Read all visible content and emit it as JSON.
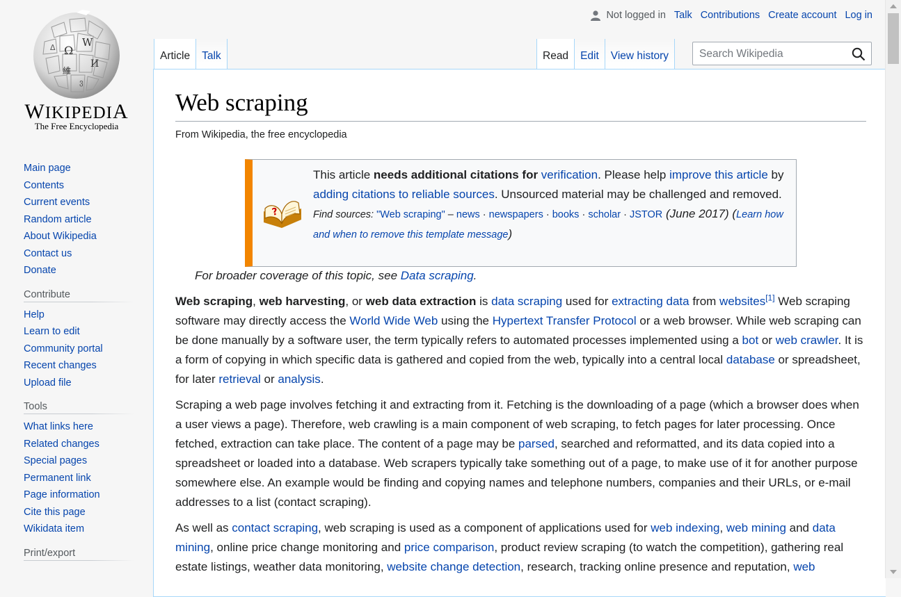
{
  "logo": {
    "wordmark": "Wikipedia",
    "tagline": "The Free Encyclopedia"
  },
  "personal": {
    "user_icon": "user-icon",
    "not_logged_in": "Not logged in",
    "talk": "Talk",
    "contributions": "Contributions",
    "create_account": "Create account",
    "login": "Log in"
  },
  "tabs_left": [
    "Article",
    "Talk"
  ],
  "tabs_right": [
    "Read",
    "Edit",
    "View history"
  ],
  "search": {
    "placeholder": "Search Wikipedia",
    "icon": "magnifier-icon"
  },
  "sidebar": {
    "navigation": [
      "Main page",
      "Contents",
      "Current events",
      "Random article",
      "About Wikipedia",
      "Contact us",
      "Donate"
    ],
    "contribute_heading": "Contribute",
    "contribute": [
      "Help",
      "Learn to edit",
      "Community portal",
      "Recent changes",
      "Upload file"
    ],
    "tools_heading": "Tools",
    "tools": [
      "What links here",
      "Related changes",
      "Special pages",
      "Permanent link",
      "Page information",
      "Cite this page",
      "Wikidata item"
    ],
    "print_heading": "Print/export"
  },
  "article": {
    "title": "Web scraping",
    "site_sub": "From Wikipedia, the free encyclopedia",
    "ambox": {
      "icon": "book-question-icon",
      "t1": "This article ",
      "t2": "needs additional citations for ",
      "t3": "verification",
      "t4": ". Please help ",
      "t5": "improve this article",
      "t6": " by ",
      "t7": "adding citations to reliable sources",
      "t8": ". Unsourced material may be challenged and removed.",
      "fs_label": "Find sources: ",
      "fs_query": "\"Web scraping\"",
      "fs_dash": " – ",
      "fs_news": "news",
      "fs_newspapers": "newspapers",
      "fs_books": "books",
      "fs_scholar": "scholar",
      "fs_jstor": "JSTOR",
      "sep": " · ",
      "date": " (June 2017) ",
      "learn": "Learn how and when to remove this template message",
      "open_paren": "(",
      "close_paren": ")"
    },
    "hatnote": {
      "text": "For broader coverage of this topic, see ",
      "link": "Data scraping",
      "end": "."
    },
    "p1": {
      "b1": "Web scraping",
      "s1": ", ",
      "b2": "web harvesting",
      "s2": ", or ",
      "b3": "web data extraction",
      "s3": " is ",
      "l1": "data scraping",
      "s4": " used for ",
      "l2": "extracting data",
      "s5": " from ",
      "l3": "websites",
      "ref": "[1]",
      "s6": " Web scraping software may directly access the ",
      "l4": "World Wide Web",
      "s7": " using the ",
      "l5": "Hypertext Transfer Protocol",
      "s8": " or a web browser. While web scraping can be done manually by a software user, the term typically refers to automated processes implemented using a ",
      "l6": "bot",
      "s9": " or ",
      "l7": "web crawler",
      "s10": ". It is a form of copying in which specific data is gathered and copied from the web, typically into a central local ",
      "l8": "database",
      "s11": " or spreadsheet, for later ",
      "l9": "retrieval",
      "s12": " or ",
      "l10": "analysis",
      "s13": "."
    },
    "p2": {
      "s1": "Scraping a web page involves fetching it and extracting from it. Fetching is the downloading of a page (which a browser does when a user views a page). Therefore, web crawling is a main component of web scraping, to fetch pages for later processing. Once fetched, extraction can take place. The content of a page may be ",
      "l1": "parsed",
      "s2": ", searched and reformatted, and its data copied into a spreadsheet or loaded into a database. Web scrapers typically take something out of a page, to make use of it for another purpose somewhere else. An example would be finding and copying names and telephone numbers, companies and their URLs, or e-mail addresses to a list (contact scraping)."
    },
    "p3": {
      "s1": "As well as ",
      "l1": "contact scraping",
      "s2": ", web scraping is used as a component of applications used for ",
      "l2": "web indexing",
      "s3": ", ",
      "l3": "web mining",
      "s4": " and ",
      "l4": "data mining",
      "s5": ", online price change monitoring and ",
      "l5": "price comparison",
      "s6": ", product review scraping (to watch the competition), gathering real estate listings, weather data monitoring, ",
      "l6": "website change detection",
      "s7": ", research, tracking online presence and reputation, ",
      "l7": "web"
    }
  }
}
